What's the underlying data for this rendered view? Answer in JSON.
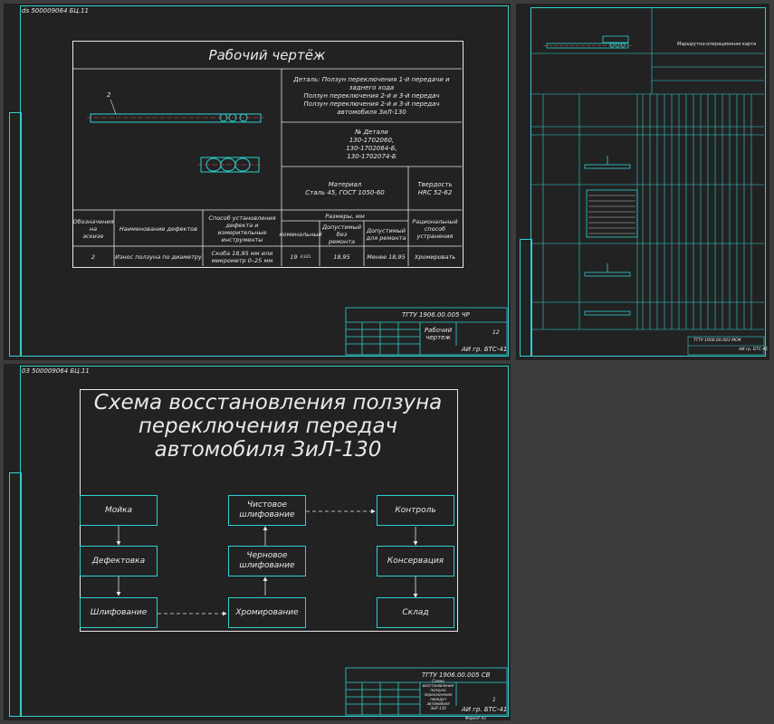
{
  "colors": {
    "background": "#3c3c3c",
    "sheet": "#222222",
    "frame": "#2fd0d0",
    "ink": "#e8e8e8"
  },
  "sheet1": {
    "corner_code": "ds 500009064 БЦ.11",
    "title": "Рабочий чертёж",
    "part_name": "Деталь: Ползун переключения 1-й передачи и заднего хода\nПолзун переключения 2-й и 3-й передач\nПолзун переключения 2-й и 3-й передач\nавтомобиля ЗиЛ-130",
    "part_numbers": "№ Детали\n130-1702060,\n130-1702064-Б,\n130-1702074-Б",
    "material": "Материал\nСталь 45, ГОСТ 1050-60",
    "hardness": "Твердость\nHRC 52-62",
    "callout": "2",
    "headers": {
      "designation": "Обозначения\nна\nэскизе",
      "defect": "Наименование дефектов",
      "method": "Способ установления\nдефекта и измерительные\nинструменты",
      "sizes": "Размеры, мм",
      "nominal": "номинальный",
      "allowed_no_repair": "Допустимый\nбез\nремонта",
      "allowed_repair": "Допустимый\nдля ремонта",
      "repair_method": "Рациональный\nспособ\nустранения"
    },
    "row": {
      "designation": "2",
      "defect": "Износ ползуна по диаметру",
      "method": "Скоба 18,95 мм или\nмикрометр 0–25 мм",
      "nominal": "19",
      "nominal_tol": "-0,021",
      "allowed_no_repair": "18,95",
      "allowed_repair": "Менее 18,95",
      "repair_method": "Хромировать"
    },
    "stamp": {
      "code": "ТГТУ 1906.00.005 ЧР",
      "name": "Рабочий\nчертеж",
      "sheets": "12",
      "group": "АИ гр. БТС-41"
    }
  },
  "sheet2": {
    "header": "Маршрутно-операционная карта",
    "stamp": {
      "code": "ТГТУ 1906.00.003 МОК",
      "group": "АИ гр. БТС-41"
    }
  },
  "sheet3": {
    "corner_code": "03 500009064 БЦ.11",
    "title": "Схема восстановления ползуна\nпереключения передач\nавтомобиля ЗиЛ-130",
    "steps": {
      "moika": "Мойка",
      "defect": "Дефектовка",
      "shlif": "Шлифование",
      "chist": "Чистовое\nшлифование",
      "chern": "Черновое\nшлифование",
      "chrom": "Хромирование",
      "control": "Контроль",
      "conserv": "Консервация",
      "sklad": "Склад"
    },
    "stamp": {
      "code": "ТГТУ 1906.00.005 СВ",
      "name": "Схема восстановления ползуна\nпереключения передач\nавтомобиля ЗиЛ-130",
      "sheets": "1",
      "group": "АИ гр. БТС-41",
      "format": "Формат А3"
    }
  }
}
